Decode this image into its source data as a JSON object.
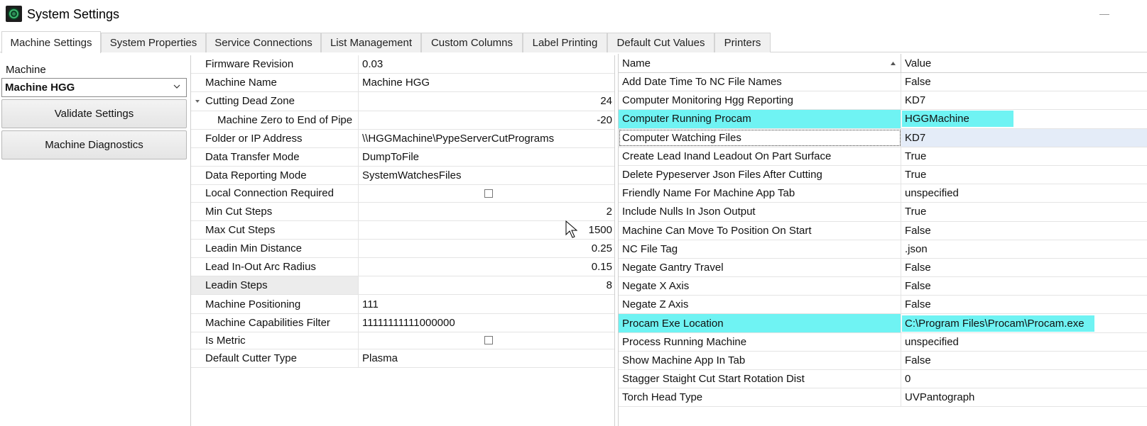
{
  "window": {
    "title": "System Settings",
    "icon": "app-icon"
  },
  "tabs": [
    {
      "label": "Machine Settings",
      "active": true
    },
    {
      "label": "System Properties"
    },
    {
      "label": "Service Connections"
    },
    {
      "label": "List Management"
    },
    {
      "label": "Custom Columns"
    },
    {
      "label": "Label Printing"
    },
    {
      "label": "Default Cut Values"
    },
    {
      "label": "Printers"
    }
  ],
  "left": {
    "machine_label": "Machine",
    "machine_selected": "Machine HGG",
    "validate_button": "Validate Settings",
    "diagnostics_button": "Machine Diagnostics"
  },
  "properties": [
    {
      "name": "Firmware Revision",
      "value": "0.03"
    },
    {
      "name": "Machine Name",
      "value": "Machine HGG"
    },
    {
      "name": "Cutting Dead Zone",
      "value": "24",
      "align": "right",
      "expander": true
    },
    {
      "name": "Machine Zero to End of Pipe",
      "value": "-20",
      "align": "right",
      "indent": true
    },
    {
      "name": "Folder or IP Address",
      "value": "\\\\HGGMachine\\PypeServerCutPrograms"
    },
    {
      "name": "Data Transfer Mode",
      "value": "DumpToFile"
    },
    {
      "name": "Data Reporting Mode",
      "value": "SystemWatchesFiles"
    },
    {
      "name": "Local Connection Required",
      "value": "",
      "checkbox": true,
      "checked": false
    },
    {
      "name": "Min Cut Steps",
      "value": "2",
      "align": "right"
    },
    {
      "name": "Max Cut Steps",
      "value": "1500",
      "align": "right"
    },
    {
      "name": "Leadin Min Distance",
      "value": "0.25",
      "align": "right"
    },
    {
      "name": "Lead In-Out Arc Radius",
      "value": "0.15",
      "align": "right"
    },
    {
      "name": "Leadin Steps",
      "value": "8",
      "align": "right",
      "selected": true
    },
    {
      "name": "Machine Positioning",
      "value": "111"
    },
    {
      "name": "Machine Capabilities Filter",
      "value": "11111111111000000"
    },
    {
      "name": "Is Metric",
      "value": "",
      "checkbox": true,
      "checked": false
    },
    {
      "name": "Default Cutter Type",
      "value": "Plasma"
    }
  ],
  "right_grid": {
    "headers": {
      "name": "Name",
      "value": "Value"
    },
    "rows": [
      {
        "name": "Add Date Time To NC File Names",
        "value": "False"
      },
      {
        "name": "Computer Monitoring Hgg Reporting",
        "value": "KD7"
      },
      {
        "name": "Computer Running Procam",
        "value": "HGGMachine",
        "highlight": "hl"
      },
      {
        "name": "Computer Watching Files",
        "value": "KD7",
        "current": true
      },
      {
        "name": "Create Lead Inand Leadout On Part Surface",
        "value": "True"
      },
      {
        "name": "Delete Pypeserver Json Files After Cutting",
        "value": "True"
      },
      {
        "name": "Friendly Name For Machine App Tab",
        "value": "unspecified"
      },
      {
        "name": "Include Nulls In Json Output",
        "value": "True"
      },
      {
        "name": "Machine Can Move To Position On Start",
        "value": "False"
      },
      {
        "name": "NC File Tag",
        "value": ".json"
      },
      {
        "name": "Negate Gantry Travel",
        "value": "False"
      },
      {
        "name": "Negate X Axis",
        "value": "False"
      },
      {
        "name": "Negate Z Axis",
        "value": "False"
      },
      {
        "name": "Procam Exe Location",
        "value": "C:\\Program Files\\Procam\\Procam.exe",
        "highlight": "hl2"
      },
      {
        "name": "Process Running Machine",
        "value": "unspecified"
      },
      {
        "name": "Show Machine App In Tab",
        "value": "False"
      },
      {
        "name": "Stagger Staight Cut Start Rotation Dist",
        "value": "0"
      },
      {
        "name": "Torch Head Type",
        "value": "UVPantograph"
      }
    ]
  },
  "colors": {
    "highlight": "#6ff3f3",
    "selected_row": "#e4ecf8",
    "tab_inactive": "#f0f0f0"
  }
}
